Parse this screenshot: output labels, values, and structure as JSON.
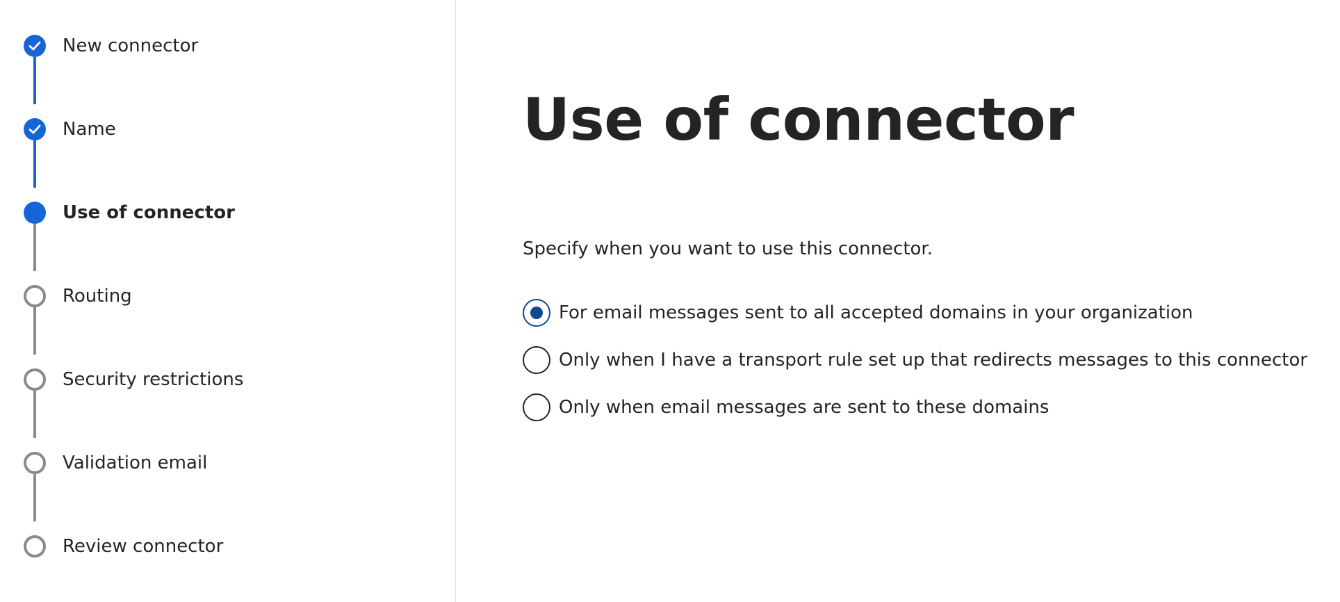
{
  "stepper": {
    "steps": [
      {
        "label": "New connector",
        "state": "done"
      },
      {
        "label": "Name",
        "state": "done"
      },
      {
        "label": "Use of connector",
        "state": "current"
      },
      {
        "label": "Routing",
        "state": "todo"
      },
      {
        "label": "Security restrictions",
        "state": "todo"
      },
      {
        "label": "Validation email",
        "state": "todo"
      },
      {
        "label": "Review connector",
        "state": "todo"
      }
    ]
  },
  "main": {
    "title": "Use of connector",
    "description": "Specify when you want to use this connector.",
    "options": [
      {
        "label": "For email messages sent to all accepted domains in your organization",
        "selected": true
      },
      {
        "label": "Only when I have a transport rule set up that redirects messages to this connector",
        "selected": false
      },
      {
        "label": "Only when email messages are sent to these domains",
        "selected": false
      }
    ]
  },
  "colors": {
    "accent": "#1565d6",
    "radio_selected": "#0e4a8f",
    "pending": "#8a8a8a"
  },
  "icons": {
    "done": "checkmark-icon"
  }
}
